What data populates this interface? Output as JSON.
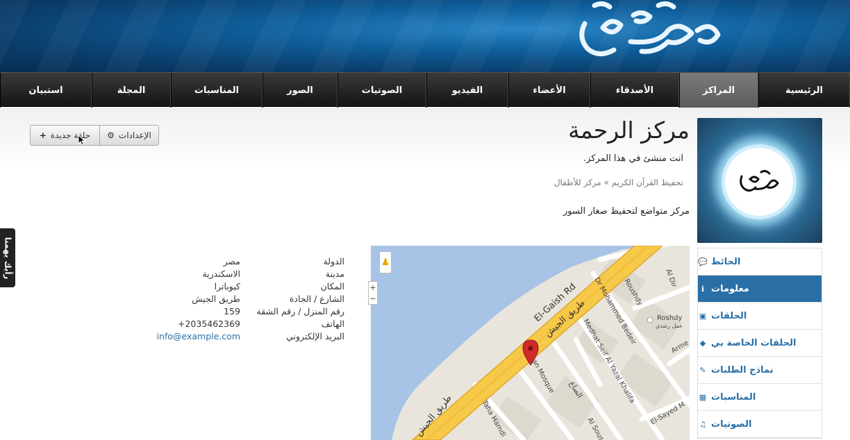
{
  "nav": {
    "items": [
      {
        "label": "الرئيسية",
        "active": false
      },
      {
        "label": "المراكز",
        "active": true
      },
      {
        "label": "الأصدقاء",
        "active": false
      },
      {
        "label": "الأعضاء",
        "active": false
      },
      {
        "label": "الفيديو",
        "active": false
      },
      {
        "label": "الصوتيات",
        "active": false
      },
      {
        "label": "الصور",
        "active": false
      },
      {
        "label": "المناسبات",
        "active": false
      },
      {
        "label": "المجلة",
        "active": false
      },
      {
        "label": "استبيان",
        "active": false
      }
    ]
  },
  "toolbar": {
    "settings_label": "الإعدادات",
    "new_circle_label": "حلقة جديدة"
  },
  "center": {
    "title": "مركز الرحمة",
    "creator_note": "انت منشئ في هذا المركز.",
    "breadcrumb": "تحفيظ القرآن الكريم » مركز للأطفال",
    "description": "مركز متواضع لتحفيظ صغار السور"
  },
  "sidebar": {
    "items": [
      {
        "label": "الحائط",
        "icon": "comments-icon",
        "glyph": "💬",
        "active": false
      },
      {
        "label": "معلومات",
        "icon": "info-icon",
        "glyph": "ℹ",
        "active": true
      },
      {
        "label": "الحلقات",
        "icon": "briefcase-icon",
        "glyph": "▣",
        "active": false
      },
      {
        "label": "الحلقات الخاصة بي",
        "icon": "tag-icon",
        "glyph": "◆",
        "active": false
      },
      {
        "label": "نماذج الطلبات",
        "icon": "pencil-icon",
        "glyph": "✎",
        "active": false
      },
      {
        "label": "المناسبات",
        "icon": "calendar-icon",
        "glyph": "▦",
        "active": false
      },
      {
        "label": "الصوتيات",
        "icon": "music-icon",
        "glyph": "♫",
        "active": false
      }
    ]
  },
  "info": {
    "rows": [
      {
        "label": "الدولة",
        "value": "مصر"
      },
      {
        "label": "مدينة",
        "value": "الاسكندرية"
      },
      {
        "label": "المكان",
        "value": "كيوباترا"
      },
      {
        "label": "الشارع / الجادة",
        "value": "طريق الجيش"
      },
      {
        "label": "رقم المنزل / رقم الشقة",
        "value": "159"
      },
      {
        "label": "الهاتف",
        "value": "+2035462369"
      },
      {
        "label": "البريد الإلكتروني",
        "value": "info@example.com",
        "link": true
      }
    ]
  },
  "map": {
    "labels": {
      "road_en": "El-Gaish Rd",
      "road_ar": "طريق الجيش",
      "road_ar_lower": "طريق الجيش",
      "street1": "Dr Mohammed Bedeir",
      "street2": "Medhat Seif Al Yazal Khalifa",
      "street3": "Roushdy",
      "street4": "Al Dir",
      "street5": "Taha Hamdi",
      "street6": "El-Sayed M",
      "street7": "Al Sous",
      "street8": "Arme",
      "street9": "الصاغ",
      "poi": "Roshdy",
      "poi_ar": "عمل رشدي",
      "mosque": "an Mosque"
    },
    "zoom_in": "+",
    "zoom_out": "−"
  },
  "feedback": {
    "label": "رأيك يهمنا"
  },
  "colors": {
    "accent": "#2a6fa6",
    "nav_bg": "#1f1f1f",
    "road": "#f7c948",
    "water": "#a7c3e6"
  }
}
